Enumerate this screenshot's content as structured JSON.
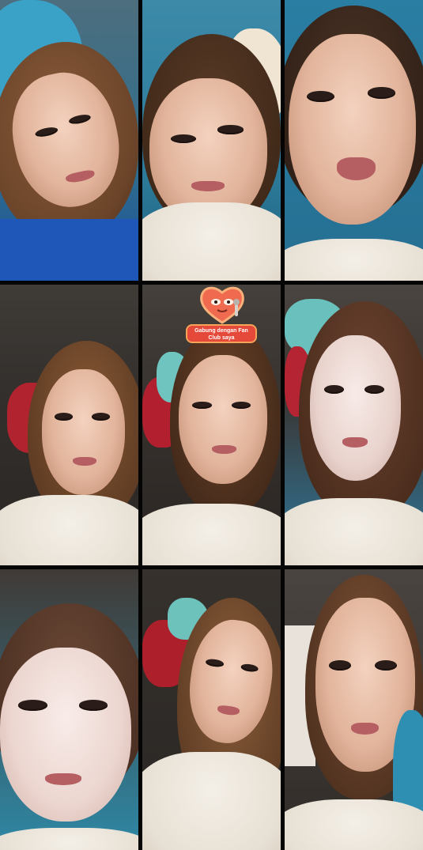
{
  "app": {
    "title": ""
  },
  "colors": {
    "divider": "#050505",
    "sticker_pill": "#e4493a",
    "sticker_border": "#f6a35a",
    "sticker_heart": "#f06a50"
  },
  "sticker": {
    "icon": "heart-mascot-icon",
    "text": "Gabung dengan Fan Club saya"
  },
  "tiles": [
    {
      "id": "t1",
      "icon": "video-feed"
    },
    {
      "id": "t2",
      "icon": "video-feed"
    },
    {
      "id": "t3",
      "icon": "video-feed"
    },
    {
      "id": "t4",
      "icon": "video-feed"
    },
    {
      "id": "t5",
      "icon": "video-feed"
    },
    {
      "id": "t6",
      "icon": "video-feed"
    },
    {
      "id": "t7",
      "icon": "video-feed"
    },
    {
      "id": "t8",
      "icon": "video-feed"
    },
    {
      "id": "t9",
      "icon": "video-feed"
    }
  ]
}
